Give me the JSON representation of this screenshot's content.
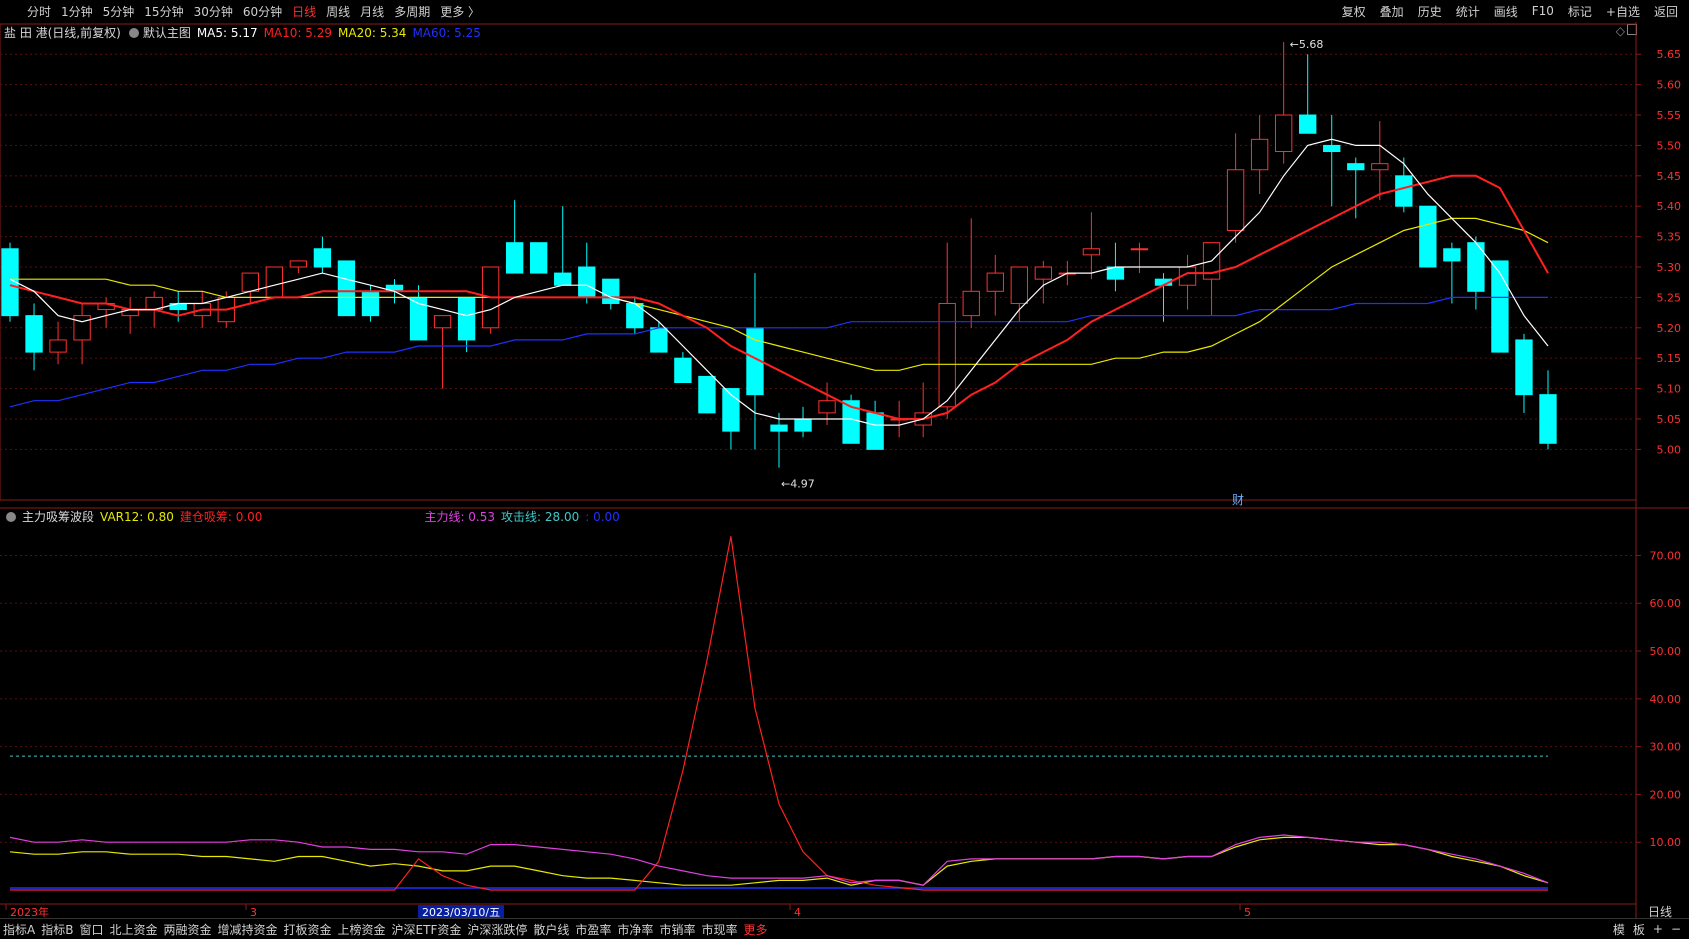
{
  "toolbar": {
    "left_items": [
      "分时",
      "1分钟",
      "5分钟",
      "15分钟",
      "30分钟",
      "60分钟",
      "日线",
      "周线",
      "月线",
      "多周期",
      "更多 〉"
    ],
    "active_index": 6,
    "right_items": [
      "复权",
      "叠加",
      "历史",
      "统计",
      "画线",
      "F10",
      "标记",
      "+自选",
      "返回"
    ]
  },
  "main_legend": {
    "stock": "盐 田 港(日线,前复权)",
    "template": "默认主图",
    "ma5": "MA5: 5.17",
    "ma10": "MA10: 5.29",
    "ma20": "MA20: 5.34",
    "ma60": "MA60: 5.25",
    "colors": {
      "ma5": "#ffffff",
      "ma10": "#ff2020",
      "ma20": "#e8e800",
      "ma60": "#2030ff"
    }
  },
  "sub_legend": {
    "name": "主力吸筹波段",
    "var12": "VAR12: 0.80",
    "jianchang": "建仓吸筹: 0.00",
    "zhuli": "主力线: 0.53",
    "gongji": "攻击线: 28.00",
    "extra": ": 0.00",
    "colors": {
      "var12": "#e8e800",
      "jianchang": "#ff2020",
      "zhuli": "#e040e0",
      "gongji": "#40c8c8",
      "extra": "#2030ff"
    }
  },
  "annotations": {
    "high": "5.68",
    "low": "4.97",
    "cai": "财"
  },
  "date_axis": {
    "labels": [
      "2023年",
      "3",
      "2023/03/10/五",
      "4",
      "5"
    ],
    "right_label": "日线"
  },
  "bottombar": {
    "items": [
      "指标A",
      "指标B",
      "窗口",
      "北上资金",
      "两融资金",
      "增减持资金",
      "打板资金",
      "上榜资金",
      "沪深ETF资金",
      "沪深涨跌停",
      "散户线",
      "市盈率",
      "市净率",
      "市销率",
      "市现率",
      "更多"
    ],
    "highlight_index": 15,
    "right_items": [
      "模",
      "板",
      "+",
      "−"
    ]
  },
  "chart_data": [
    {
      "type": "candlestick",
      "title": "盐 田 港(日线,前复权)",
      "ylim": [
        4.92,
        5.68
      ],
      "y_ticks": [
        5.0,
        5.05,
        5.1,
        5.15,
        5.2,
        5.25,
        5.3,
        5.35,
        5.4,
        5.45,
        5.5,
        5.55,
        5.6,
        5.65
      ],
      "candles": [
        [
          5.33,
          5.34,
          5.21,
          5.22
        ],
        [
          5.22,
          5.24,
          5.13,
          5.16
        ],
        [
          5.16,
          5.21,
          5.14,
          5.18
        ],
        [
          5.18,
          5.24,
          5.14,
          5.22
        ],
        [
          5.23,
          5.25,
          5.2,
          5.24
        ],
        [
          5.22,
          5.25,
          5.19,
          5.23
        ],
        [
          5.23,
          5.26,
          5.2,
          5.25
        ],
        [
          5.24,
          5.26,
          5.21,
          5.23
        ],
        [
          5.22,
          5.26,
          5.2,
          5.24
        ],
        [
          5.21,
          5.26,
          5.2,
          5.25
        ],
        [
          5.26,
          5.29,
          5.24,
          5.29
        ],
        [
          5.25,
          5.3,
          5.25,
          5.3
        ],
        [
          5.3,
          5.31,
          5.29,
          5.31
        ],
        [
          5.33,
          5.35,
          5.29,
          5.3
        ],
        [
          5.31,
          5.31,
          5.22,
          5.22
        ],
        [
          5.26,
          5.27,
          5.21,
          5.22
        ],
        [
          5.27,
          5.28,
          5.24,
          5.26
        ],
        [
          5.25,
          5.27,
          5.18,
          5.18
        ],
        [
          5.2,
          5.21,
          5.1,
          5.22
        ],
        [
          5.25,
          5.25,
          5.16,
          5.18
        ],
        [
          5.2,
          5.26,
          5.19,
          5.3
        ],
        [
          5.34,
          5.41,
          5.3,
          5.29
        ],
        [
          5.34,
          5.34,
          5.29,
          5.29
        ],
        [
          5.29,
          5.4,
          5.27,
          5.27
        ],
        [
          5.3,
          5.34,
          5.24,
          5.25
        ],
        [
          5.28,
          5.28,
          5.23,
          5.24
        ],
        [
          5.24,
          5.25,
          5.19,
          5.2
        ],
        [
          5.2,
          5.21,
          5.16,
          5.16
        ],
        [
          5.15,
          5.16,
          5.12,
          5.11
        ],
        [
          5.12,
          5.12,
          5.06,
          5.06
        ],
        [
          5.1,
          5.1,
          5.0,
          5.03
        ],
        [
          5.2,
          5.29,
          5.0,
          5.09
        ],
        [
          5.04,
          5.06,
          4.97,
          5.03
        ],
        [
          5.05,
          5.07,
          5.02,
          5.03
        ],
        [
          5.06,
          5.11,
          5.04,
          5.08
        ],
        [
          5.08,
          5.09,
          5.01,
          5.01
        ],
        [
          5.06,
          5.08,
          5.01,
          5.0
        ],
        [
          5.05,
          5.08,
          5.02,
          5.05
        ],
        [
          5.04,
          5.11,
          5.02,
          5.06
        ],
        [
          5.07,
          5.34,
          5.05,
          5.24
        ],
        [
          5.22,
          5.38,
          5.2,
          5.26
        ],
        [
          5.26,
          5.32,
          5.22,
          5.29
        ],
        [
          5.24,
          5.3,
          5.21,
          5.3
        ],
        [
          5.28,
          5.31,
          5.24,
          5.3
        ],
        [
          5.29,
          5.31,
          5.27,
          5.29
        ],
        [
          5.32,
          5.39,
          5.28,
          5.33
        ],
        [
          5.3,
          5.34,
          5.26,
          5.28
        ],
        [
          5.33,
          5.34,
          5.29,
          5.33
        ],
        [
          5.28,
          5.29,
          5.21,
          5.27
        ],
        [
          5.27,
          5.32,
          5.23,
          5.3
        ],
        [
          5.28,
          5.34,
          5.22,
          5.34
        ],
        [
          5.36,
          5.52,
          5.34,
          5.46
        ],
        [
          5.46,
          5.55,
          5.42,
          5.51
        ],
        [
          5.49,
          5.67,
          5.47,
          5.55
        ],
        [
          5.55,
          5.65,
          5.53,
          5.52
        ],
        [
          5.5,
          5.55,
          5.4,
          5.49
        ],
        [
          5.47,
          5.48,
          5.38,
          5.46
        ],
        [
          5.46,
          5.54,
          5.41,
          5.47
        ],
        [
          5.45,
          5.48,
          5.39,
          5.4
        ],
        [
          5.4,
          5.4,
          5.33,
          5.3
        ],
        [
          5.33,
          5.34,
          5.24,
          5.31
        ],
        [
          5.34,
          5.35,
          5.23,
          5.26
        ],
        [
          5.31,
          5.31,
          5.16,
          5.16
        ],
        [
          5.18,
          5.19,
          5.06,
          5.09
        ],
        [
          5.09,
          5.13,
          5.0,
          5.01
        ]
      ],
      "ma5": [
        5.28,
        5.26,
        5.22,
        5.21,
        5.22,
        5.23,
        5.23,
        5.24,
        5.24,
        5.25,
        5.26,
        5.27,
        5.28,
        5.29,
        5.28,
        5.27,
        5.26,
        5.24,
        5.23,
        5.22,
        5.23,
        5.25,
        5.26,
        5.27,
        5.27,
        5.25,
        5.24,
        5.21,
        5.17,
        5.13,
        5.09,
        5.06,
        5.05,
        5.05,
        5.05,
        5.05,
        5.04,
        5.04,
        5.05,
        5.08,
        5.13,
        5.18,
        5.23,
        5.27,
        5.29,
        5.29,
        5.3,
        5.3,
        5.3,
        5.3,
        5.31,
        5.35,
        5.39,
        5.45,
        5.5,
        5.51,
        5.5,
        5.5,
        5.47,
        5.42,
        5.38,
        5.34,
        5.29,
        5.22,
        5.17
      ],
      "ma10": [
        5.27,
        5.26,
        5.25,
        5.24,
        5.24,
        5.23,
        5.23,
        5.22,
        5.23,
        5.23,
        5.24,
        5.25,
        5.25,
        5.26,
        5.26,
        5.26,
        5.26,
        5.26,
        5.26,
        5.26,
        5.25,
        5.25,
        5.25,
        5.25,
        5.25,
        5.25,
        5.25,
        5.24,
        5.22,
        5.2,
        5.17,
        5.15,
        5.13,
        5.11,
        5.09,
        5.07,
        5.06,
        5.05,
        5.05,
        5.06,
        5.09,
        5.11,
        5.14,
        5.16,
        5.18,
        5.21,
        5.23,
        5.25,
        5.27,
        5.29,
        5.29,
        5.3,
        5.32,
        5.34,
        5.36,
        5.38,
        5.4,
        5.42,
        5.43,
        5.44,
        5.45,
        5.45,
        5.43,
        5.36,
        5.29
      ],
      "ma20": [
        5.28,
        5.28,
        5.28,
        5.28,
        5.28,
        5.27,
        5.27,
        5.26,
        5.26,
        5.25,
        5.25,
        5.25,
        5.25,
        5.25,
        5.25,
        5.25,
        5.25,
        5.25,
        5.25,
        5.25,
        5.25,
        5.25,
        5.25,
        5.25,
        5.25,
        5.25,
        5.24,
        5.23,
        5.22,
        5.21,
        5.2,
        5.18,
        5.17,
        5.16,
        5.15,
        5.14,
        5.13,
        5.13,
        5.14,
        5.14,
        5.14,
        5.14,
        5.14,
        5.14,
        5.14,
        5.14,
        5.15,
        5.15,
        5.16,
        5.16,
        5.17,
        5.19,
        5.21,
        5.24,
        5.27,
        5.3,
        5.32,
        5.34,
        5.36,
        5.37,
        5.38,
        5.38,
        5.37,
        5.36,
        5.34
      ],
      "ma60": [
        5.07,
        5.08,
        5.08,
        5.09,
        5.1,
        5.11,
        5.11,
        5.12,
        5.13,
        5.13,
        5.14,
        5.14,
        5.15,
        5.15,
        5.16,
        5.16,
        5.16,
        5.17,
        5.17,
        5.17,
        5.17,
        5.18,
        5.18,
        5.18,
        5.19,
        5.19,
        5.19,
        5.2,
        5.2,
        5.2,
        5.2,
        5.2,
        5.2,
        5.2,
        5.2,
        5.21,
        5.21,
        5.21,
        5.21,
        5.21,
        5.21,
        5.21,
        5.21,
        5.21,
        5.21,
        5.22,
        5.22,
        5.22,
        5.22,
        5.22,
        5.22,
        5.22,
        5.23,
        5.23,
        5.23,
        5.23,
        5.24,
        5.24,
        5.24,
        5.24,
        5.25,
        5.25,
        5.25,
        5.25,
        5.25
      ],
      "colors": {
        "up": "#ff3030",
        "down": "#00ffff"
      }
    },
    {
      "type": "line",
      "title": "主力吸筹波段",
      "ylim": [
        0,
        77
      ],
      "y_ticks": [
        10,
        20,
        30,
        40,
        50,
        60,
        70
      ],
      "attack_line": 28,
      "series": [
        {
          "name": "VAR12",
          "color": "#e8e800",
          "values": [
            8,
            7.5,
            7.5,
            8,
            8,
            7.5,
            7.5,
            7.5,
            7,
            7,
            6.5,
            6,
            7,
            7,
            6,
            5,
            5.5,
            5,
            4,
            4,
            5,
            5,
            4,
            3,
            2.5,
            2.5,
            2,
            1.5,
            1,
            1,
            1,
            1.5,
            2,
            2,
            2.5,
            1,
            2,
            2,
            1,
            5,
            6,
            6.5,
            6.5,
            6.5,
            6.5,
            6.5,
            7,
            7,
            6.5,
            7,
            7,
            9,
            10.5,
            11,
            11,
            10.5,
            10,
            9.5,
            9.5,
            8.5,
            7,
            6,
            5,
            3,
            1.5
          ]
        },
        {
          "name": "建仓吸筹",
          "color": "#ff2020",
          "values": [
            0,
            0,
            0,
            0,
            0,
            0,
            0,
            0,
            0,
            0,
            0,
            0,
            0,
            0,
            0,
            0,
            0,
            6.5,
            3,
            1,
            0,
            0,
            0,
            0,
            0,
            0,
            0,
            6,
            25,
            48,
            74,
            38,
            18,
            8,
            3,
            2,
            1,
            0.5,
            0,
            0,
            0,
            0,
            0,
            0,
            0,
            0,
            0,
            0,
            0,
            0,
            0,
            0,
            0,
            0,
            0,
            0,
            0,
            0,
            0,
            0,
            0,
            0,
            0,
            0,
            0
          ]
        },
        {
          "name": "主力线",
          "color": "#e040e0",
          "values": [
            11,
            10,
            10,
            10.5,
            10,
            10,
            10,
            10,
            10,
            10,
            10.5,
            10.5,
            10,
            9,
            9,
            8.5,
            8.5,
            8,
            8,
            7.5,
            9.5,
            9.5,
            9,
            8.5,
            8,
            7.5,
            6.5,
            5,
            4,
            3,
            2.5,
            2.5,
            2.5,
            2.5,
            3,
            1.5,
            2,
            2,
            1,
            6,
            6.5,
            6.5,
            6.5,
            6.5,
            6.5,
            6.5,
            7,
            7,
            6.5,
            7,
            7,
            9.5,
            11,
            11.5,
            11,
            10.5,
            10,
            10,
            9.5,
            8.5,
            7.5,
            6.5,
            5,
            3.5,
            1.5
          ]
        },
        {
          "name": "攻击线",
          "color": "#40c8c8",
          "values": []
        },
        {
          "name": "",
          "color": "#2030ff",
          "values": []
        }
      ]
    }
  ]
}
